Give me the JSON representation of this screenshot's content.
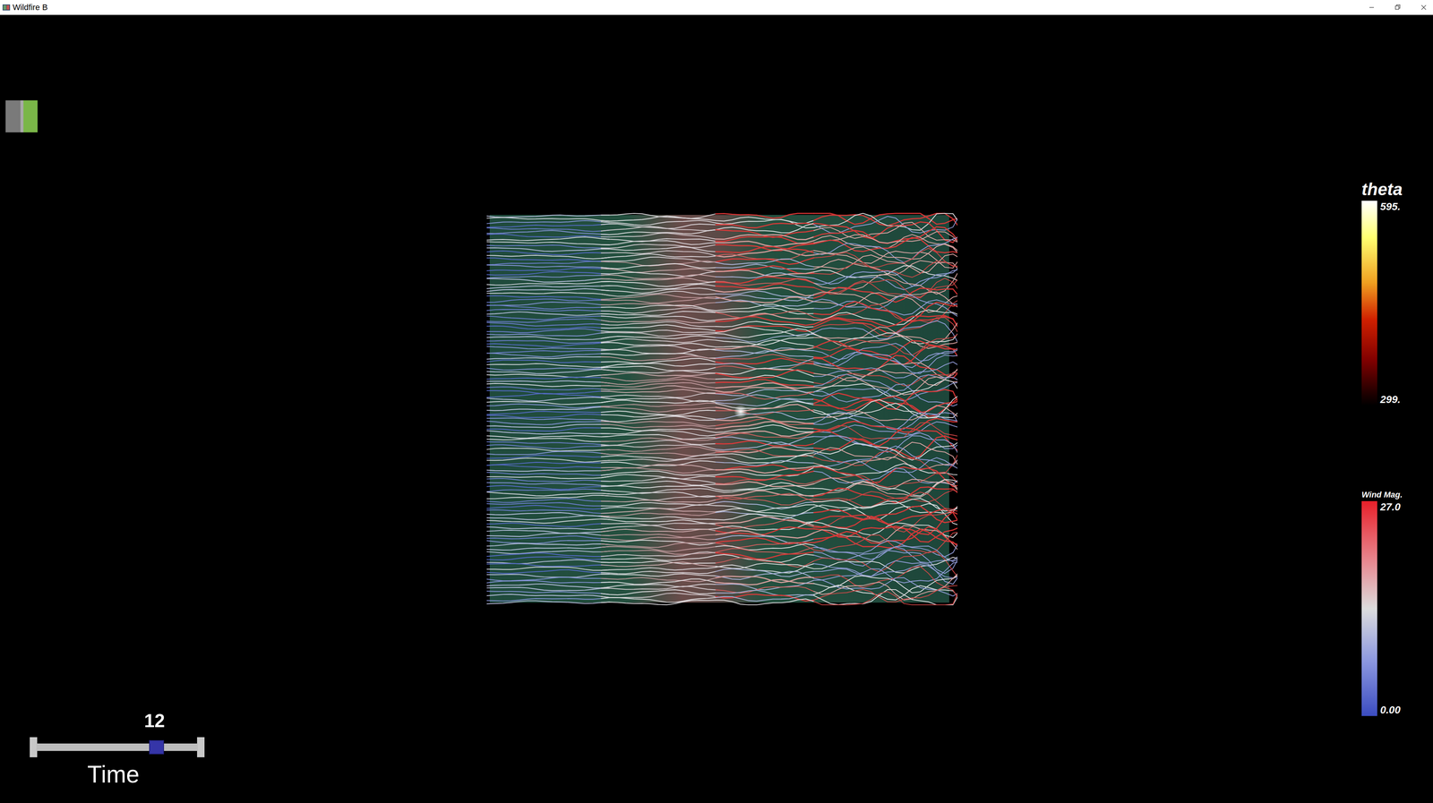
{
  "window": {
    "title": "Wildfire B"
  },
  "toggle": {
    "on": true
  },
  "colorbars": [
    {
      "title": "theta",
      "max": "595.",
      "min": "299.",
      "kind": "theta"
    },
    {
      "title": "Wind Mag.",
      "max": "27.0",
      "min": "0.00",
      "kind": "wind"
    }
  ],
  "time_slider": {
    "label": "Time",
    "value": "12",
    "level": 0.745
  }
}
